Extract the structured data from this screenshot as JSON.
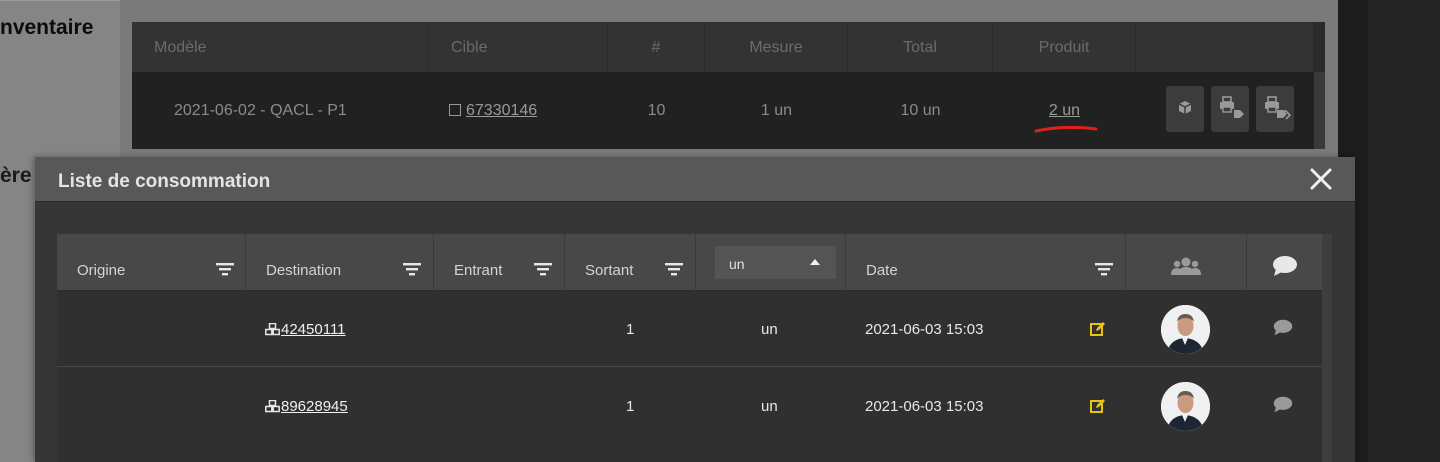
{
  "background": {
    "heading_1": "nventaire",
    "heading_2": "ère"
  },
  "top_table": {
    "columns": [
      "Modèle",
      "Cible",
      "#",
      "Mesure",
      "Total",
      "Produit",
      ""
    ],
    "row": {
      "modele": "2021-06-02 - QACL - P1",
      "cible": "67330146",
      "count": "10",
      "mesure": "1 un",
      "total": "10 un",
      "produit": "2 un"
    },
    "actions": [
      "box-icon",
      "print-tag-icon",
      "print-tags-icon"
    ]
  },
  "modal": {
    "title": "Liste de consommation",
    "close_icon": "close-icon",
    "columns": {
      "origine": "Origine",
      "destination": "Destination",
      "entrant": "Entrant",
      "sortant": "Sortant",
      "unit_select": "un",
      "date": "Date",
      "users_icon": "users-icon",
      "comments_icon": "comment-icon"
    },
    "rows": [
      {
        "origine": "",
        "destination": "42450111",
        "entrant": "",
        "sortant": "1",
        "unit": "un",
        "date": "2021-06-03 15:03"
      },
      {
        "origine": "",
        "destination": "89628945",
        "entrant": "",
        "sortant": "1",
        "unit": "un",
        "date": "2021-06-03 15:03"
      }
    ]
  },
  "colors": {
    "accent_edit": "#e8c312",
    "annotation_red": "#e0201e"
  }
}
